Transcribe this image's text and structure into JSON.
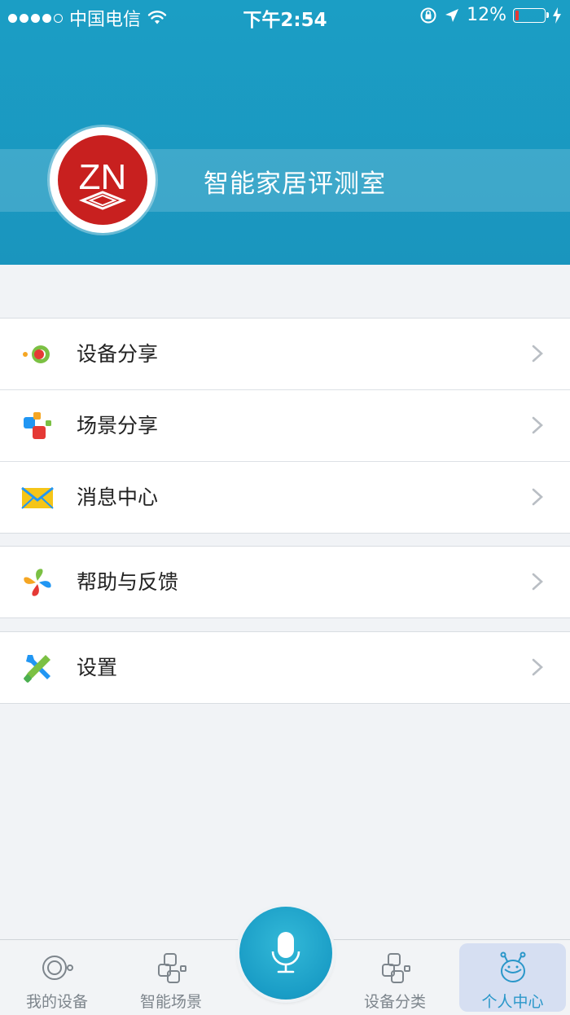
{
  "status_bar": {
    "carrier": "中国电信",
    "time": "下午2:54",
    "battery_percent": "12%",
    "battery_level": 0.12,
    "icons": [
      "signal-icon",
      "wifi-icon",
      "orientation-lock-icon",
      "location-icon",
      "battery-icon",
      "charging-icon"
    ]
  },
  "profile": {
    "avatar_logo": "ZN",
    "name": "智能家居评测室"
  },
  "menu": {
    "group1": [
      {
        "label": "设备分享",
        "icon": "device-share-icon"
      },
      {
        "label": "场景分享",
        "icon": "scene-share-icon"
      },
      {
        "label": "消息中心",
        "icon": "envelope-icon"
      }
    ],
    "group2": [
      {
        "label": "帮助与反馈",
        "icon": "help-feedback-icon"
      }
    ],
    "group3": [
      {
        "label": "设置",
        "icon": "wrench-screwdriver-icon"
      }
    ]
  },
  "tabbar": {
    "tabs": [
      {
        "label": "我的设备",
        "icon": "my-devices-icon"
      },
      {
        "label": "智能场景",
        "icon": "smart-scene-icon"
      },
      {
        "label": "设备分类",
        "icon": "device-category-icon"
      },
      {
        "label": "个人中心",
        "icon": "robot-icon",
        "active": true
      }
    ],
    "mic_icon": "microphone-icon"
  },
  "colors": {
    "header": "#1b9ec5",
    "accent": "#2a97c9",
    "avatar_red": "#c8201f",
    "background": "#f1f3f6"
  }
}
